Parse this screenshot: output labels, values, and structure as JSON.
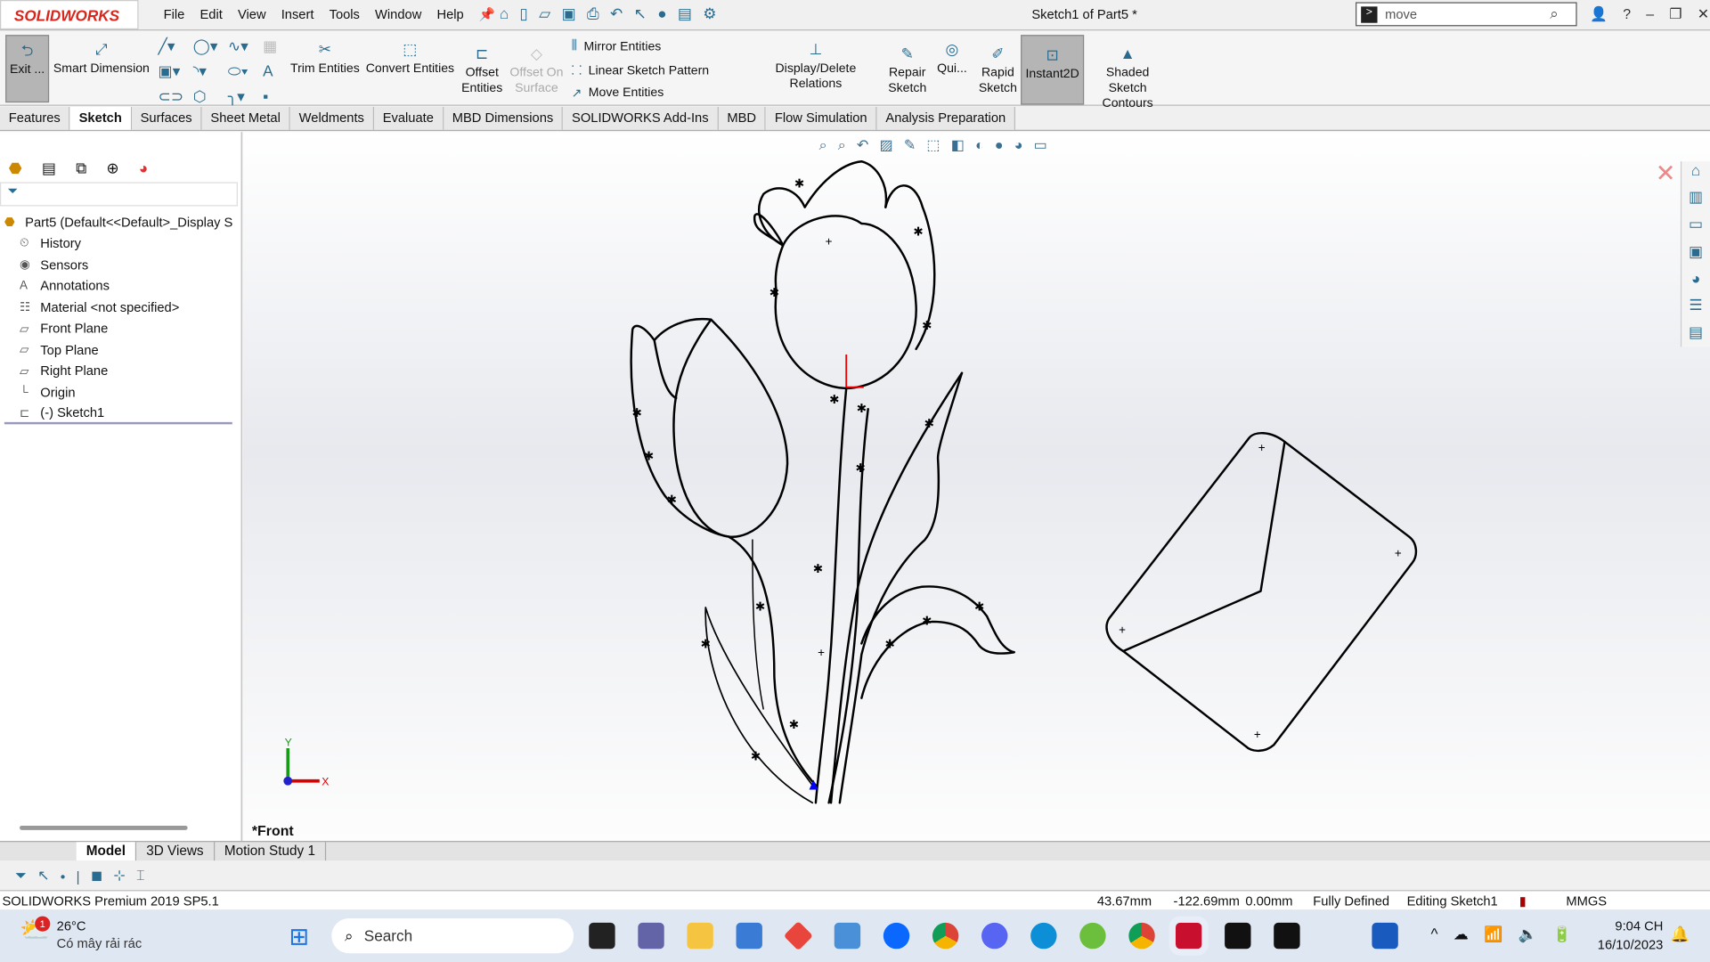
{
  "app": {
    "logo": "SOLIDWORKS",
    "title": "Sketch1 of Part5 *",
    "search_value": "move"
  },
  "menu": [
    "File",
    "Edit",
    "View",
    "Insert",
    "Tools",
    "Window",
    "Help"
  ],
  "ribbon": {
    "exit": "Exit ...",
    "smart_dimension": "Smart Dimension",
    "trim": "Trim Entities",
    "convert": "Convert Entities",
    "offset": "Offset Entities",
    "offset_surface": "Offset On Surface",
    "mirror": "Mirror Entities",
    "linear_pattern": "Linear Sketch Pattern",
    "move": "Move Entities",
    "display_relations": "Display/Delete Relations",
    "repair": "Repair Sketch",
    "quick": "Qui...",
    "rapid": "Rapid Sketch",
    "instant2d": "Instant2D",
    "shaded": "Shaded Sketch Contours"
  },
  "tabs": [
    "Features",
    "Sketch",
    "Surfaces",
    "Sheet Metal",
    "Weldments",
    "Evaluate",
    "MBD Dimensions",
    "SOLIDWORKS Add-Ins",
    "MBD",
    "Flow Simulation",
    "Analysis Preparation"
  ],
  "tree": [
    {
      "label": "Part5  (Default<<Default>_Display S",
      "icon": "part-icon"
    },
    {
      "label": "History",
      "icon": "history-icon"
    },
    {
      "label": "Sensors",
      "icon": "sensor-icon"
    },
    {
      "label": "Annotations",
      "icon": "annotation-icon"
    },
    {
      "label": "Material <not specified>",
      "icon": "material-icon"
    },
    {
      "label": "Front Plane",
      "icon": "plane-icon"
    },
    {
      "label": "Top Plane",
      "icon": "plane-icon"
    },
    {
      "label": "Right Plane",
      "icon": "plane-icon"
    },
    {
      "label": "Origin",
      "icon": "origin-icon"
    },
    {
      "label": "(-) Sketch1",
      "icon": "sketch-icon"
    }
  ],
  "view": {
    "label": "*Front",
    "axis_x": "X",
    "axis_y": "Y"
  },
  "bottom_tabs": [
    "Model",
    "3D Views",
    "Motion Study 1"
  ],
  "status": {
    "product": "SOLIDWORKS Premium 2019 SP5.1",
    "x": "43.67mm",
    "y": "-122.69mm",
    "z": "0.00mm",
    "state": "Fully Defined",
    "editing": "Editing Sketch1",
    "units": "MMGS"
  },
  "taskbar": {
    "weather_temp": "26°C",
    "weather_text": "Có mây rải rác",
    "weather_badge": "1",
    "search": "Search",
    "time": "9:04 CH",
    "date": "16/10/2023"
  },
  "colors": {
    "brand": "#d9261c",
    "accent": "#2a6c8f"
  }
}
